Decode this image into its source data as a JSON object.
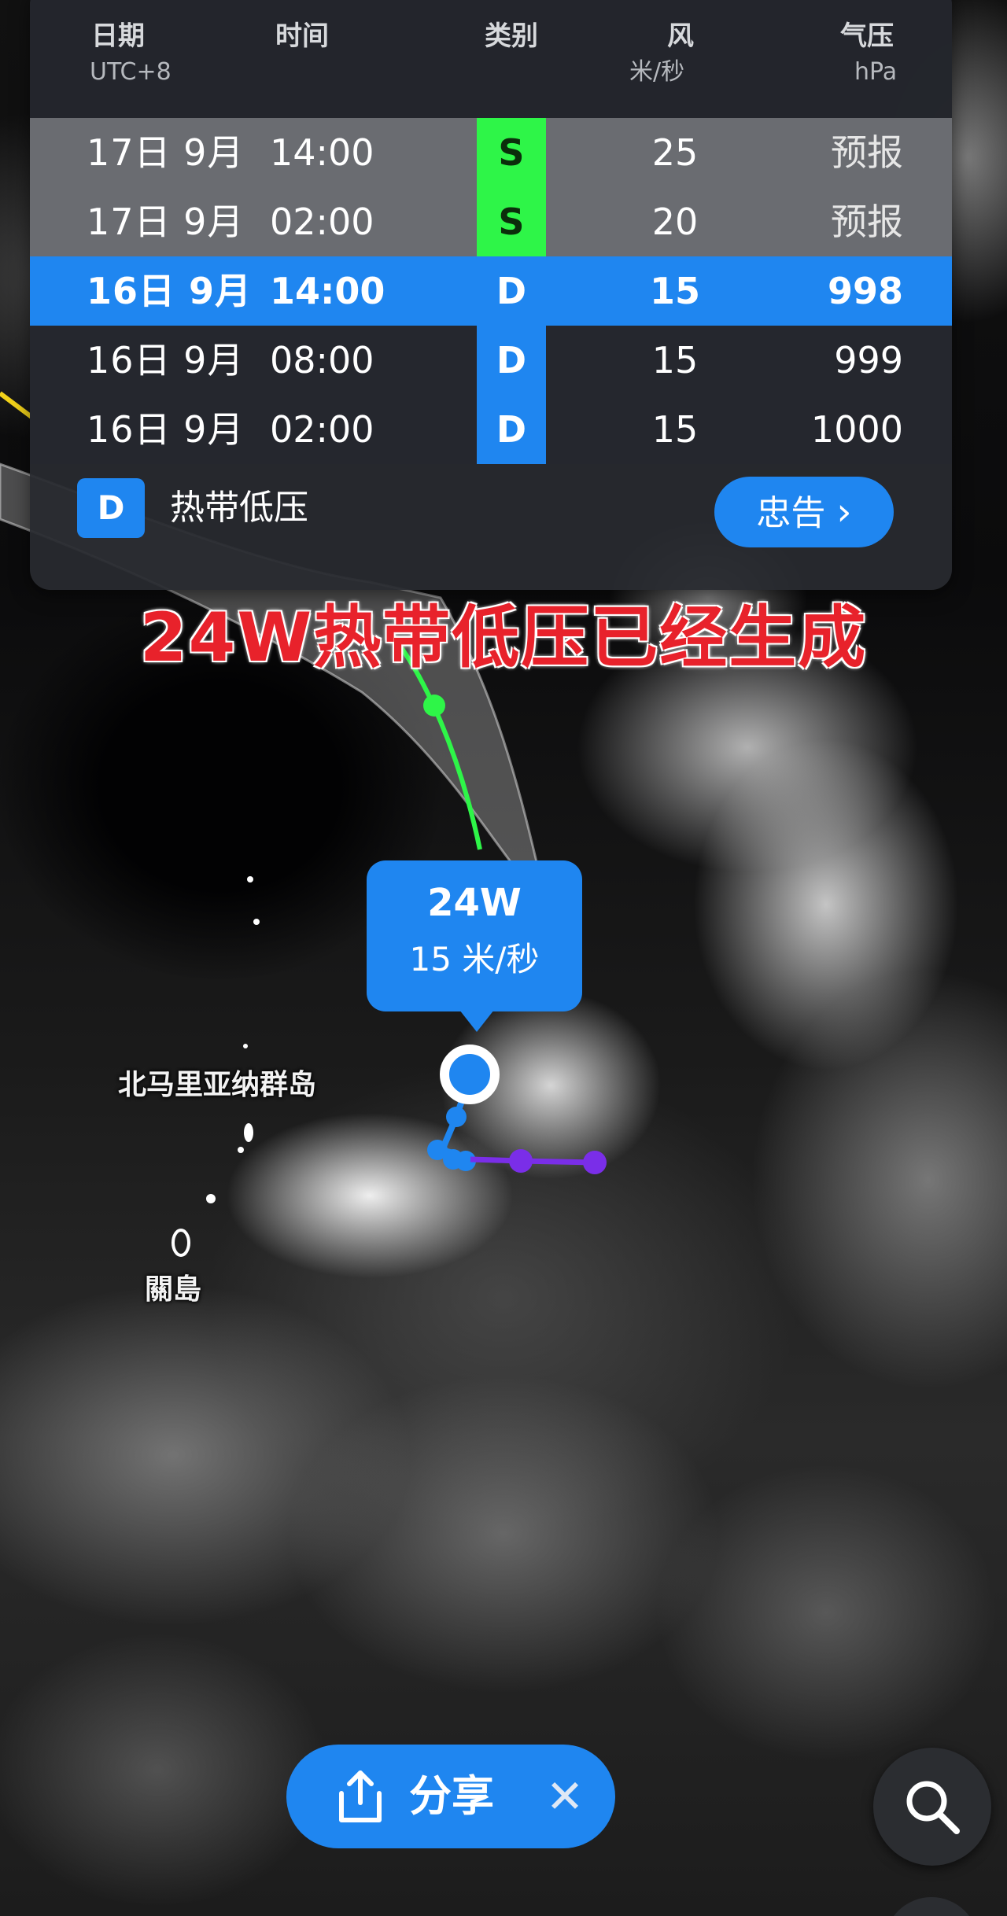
{
  "table": {
    "headers": {
      "date": "日期",
      "date_sub": "UTC+8",
      "time": "时间",
      "category": "类别",
      "wind": "风",
      "wind_sub": "米/秒",
      "pressure": "气压",
      "pressure_sub": "hPa"
    },
    "rows": [
      {
        "date": "17日 9月",
        "time": "14:00",
        "category": "S",
        "wind": "25",
        "pressure": "预报"
      },
      {
        "date": "17日 9月",
        "time": "02:00",
        "category": "S",
        "wind": "20",
        "pressure": "预报"
      },
      {
        "date": "16日 9月",
        "time": "14:00",
        "category": "D",
        "wind": "15",
        "pressure": "998"
      },
      {
        "date": "16日 9月",
        "time": "08:00",
        "category": "D",
        "wind": "15",
        "pressure": "999"
      },
      {
        "date": "16日 9月",
        "time": "02:00",
        "category": "D",
        "wind": "15",
        "pressure": "1000"
      }
    ],
    "legend": {
      "badge": "D",
      "label": "热带低压"
    },
    "advisory_button": "忠告",
    "colors": {
      "accent": "#1f86f0",
      "storm_category": "#2ef548",
      "panel": "#282a30"
    }
  },
  "headline": "24W热带低压已经生成",
  "storm": {
    "name": "24W",
    "wind": "15 米/秒"
  },
  "places": {
    "north_marianas": "北马里亚纳群岛",
    "guam": "關島"
  },
  "toolbar": {
    "share_label": "分享",
    "share_icon": "share-icon",
    "close_icon": "close-icon",
    "search_icon": "search-icon"
  }
}
